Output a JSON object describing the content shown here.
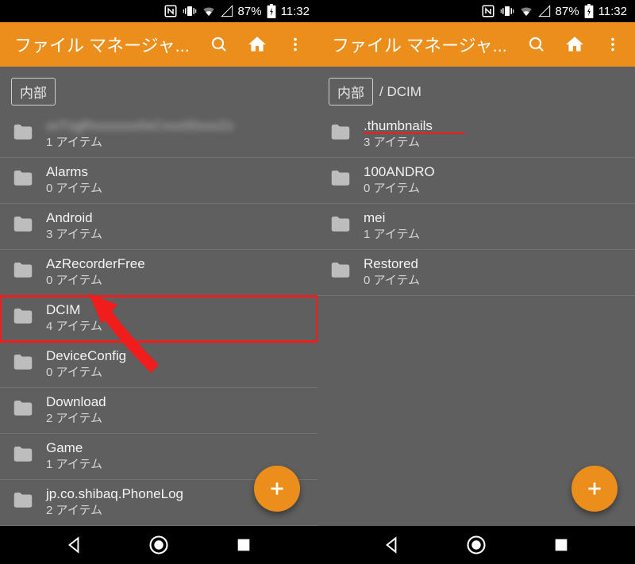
{
  "status": {
    "battery": "87%",
    "time": "11:32"
  },
  "appbar": {
    "title": "ファイル マネージャ..."
  },
  "left": {
    "crumb_root": "内部",
    "items": [
      {
        "name": "xxTxgRxxxxxxx0xCxxx00xxxZx",
        "sub": "1 アイテム",
        "blurred": true
      },
      {
        "name": "Alarms",
        "sub": "0 アイテム"
      },
      {
        "name": "Android",
        "sub": "3 アイテム"
      },
      {
        "name": "AzRecorderFree",
        "sub": "0 アイテム"
      },
      {
        "name": "DCIM",
        "sub": "4 アイテム",
        "highlight": true
      },
      {
        "name": "DeviceConfig",
        "sub": "0 アイテム"
      },
      {
        "name": "Download",
        "sub": "2 アイテム"
      },
      {
        "name": "Game",
        "sub": "1 アイテム"
      },
      {
        "name": "jp.co.shibaq.PhoneLog",
        "sub": "2 アイテム"
      }
    ]
  },
  "right": {
    "crumb_root": "内部",
    "crumb_path": "/ DCIM",
    "items": [
      {
        "name": ".thumbnails",
        "sub": "3 アイテム",
        "underline": true
      },
      {
        "name": "100ANDRO",
        "sub": "0 アイテム"
      },
      {
        "name": "mei",
        "sub": "1 アイテム"
      },
      {
        "name": "Restored",
        "sub": "0 アイテム"
      }
    ]
  }
}
